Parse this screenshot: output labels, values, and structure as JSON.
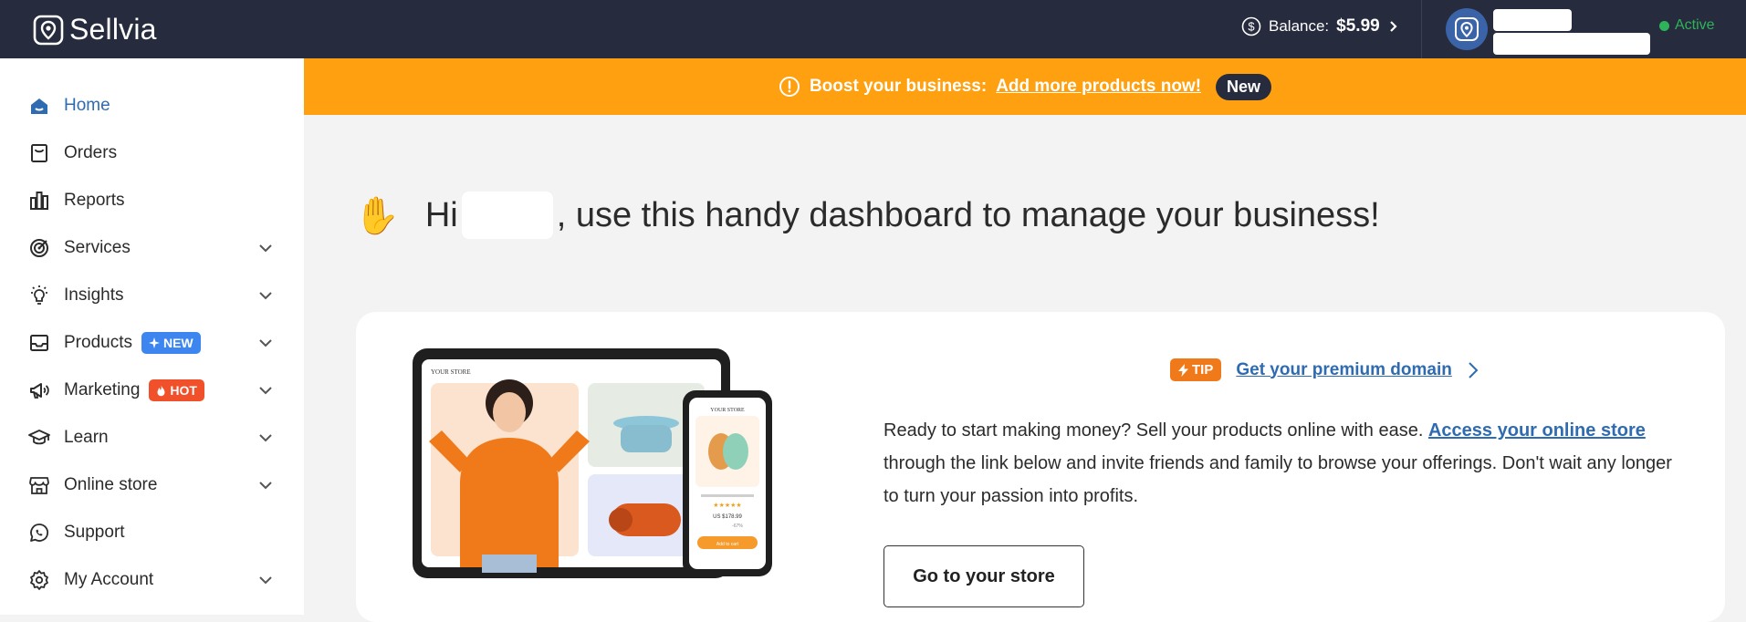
{
  "app": {
    "name": "Sellvia"
  },
  "header": {
    "balance_label": "Balance:",
    "balance_value": "$5.99",
    "status": "Active"
  },
  "sidebar": {
    "items": [
      {
        "label": "Home",
        "icon": "home-icon",
        "active": true
      },
      {
        "label": "Orders",
        "icon": "orders-icon"
      },
      {
        "label": "Reports",
        "icon": "reports-icon"
      },
      {
        "label": "Services",
        "icon": "target-icon",
        "expandable": true
      },
      {
        "label": "Insights",
        "icon": "lightbulb-icon",
        "expandable": true
      },
      {
        "label": "Products",
        "icon": "tray-icon",
        "expandable": true,
        "badge": "NEW"
      },
      {
        "label": "Marketing",
        "icon": "megaphone-icon",
        "expandable": true,
        "badge": "HOT"
      },
      {
        "label": "Learn",
        "icon": "graduation-cap-icon",
        "expandable": true
      },
      {
        "label": "Online store",
        "icon": "storefront-icon",
        "expandable": true
      },
      {
        "label": "Support",
        "icon": "chat-icon"
      },
      {
        "label": "My Account",
        "icon": "gear-icon",
        "expandable": true
      }
    ]
  },
  "banner": {
    "text": "Boost your business:",
    "link": "Add more products now!",
    "pill": "New"
  },
  "greeting": {
    "prefix": "Hi",
    "suffix": ", use this handy dashboard to manage your business!"
  },
  "card": {
    "tip_badge": "TIP",
    "tip_link": "Get your premium domain",
    "desc_1": "Ready to start making money? Sell your products online with ease.",
    "desc_link": "Access your online store",
    "desc_2": "through the link below and invite friends and family to browse your offerings. Don't wait any longer to turn your passion into profits.",
    "button": "Go to your store"
  },
  "illustration": {
    "store_label": "YOUR STORE",
    "price": "US $178.99",
    "rating": "★★★★★",
    "add_to_cart": "Add to cart",
    "discount": "-67%"
  },
  "colors": {
    "topbar": "#262b3d",
    "accent": "#2f6bb0",
    "banner": "#fea00f",
    "status": "#2fb35a",
    "new_badge": "#3d86f0",
    "hot_badge": "#f0502a",
    "tip": "#f07a1a"
  }
}
